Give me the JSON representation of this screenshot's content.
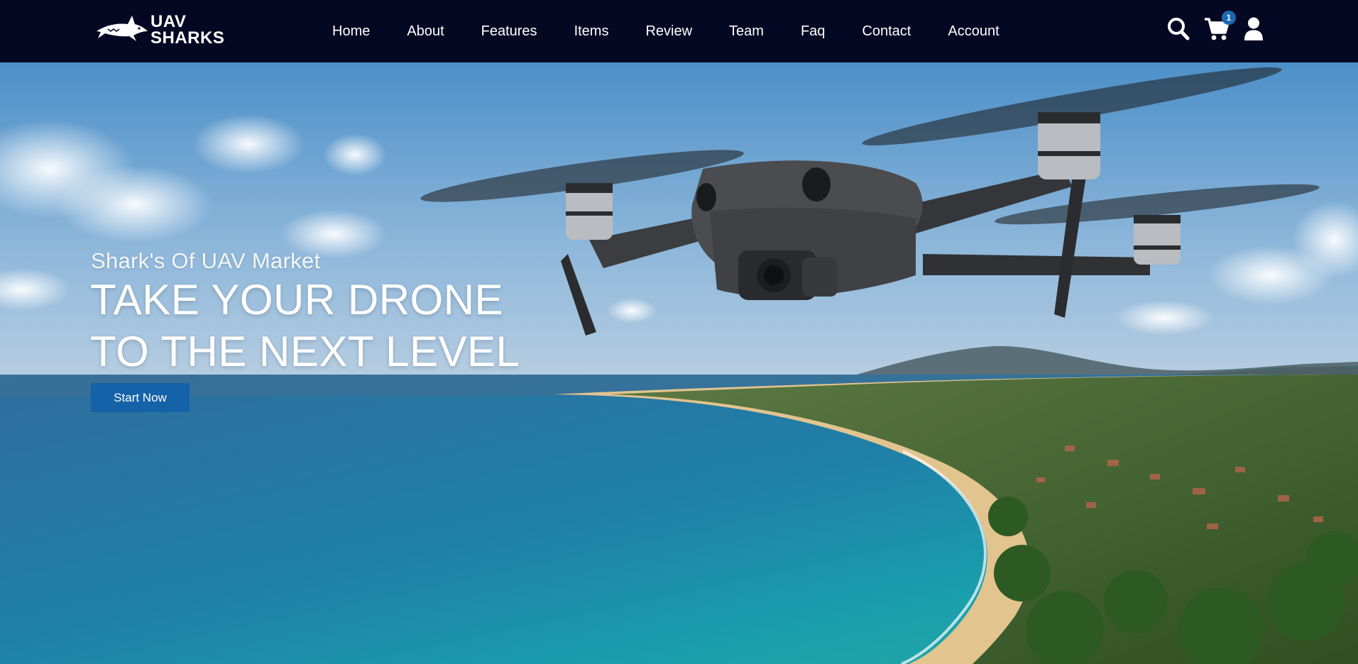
{
  "brand": {
    "line1": "UAV",
    "line2": "SHARKS"
  },
  "nav": {
    "links": [
      "Home",
      "About",
      "Features",
      "Items",
      "Review",
      "Team",
      "Faq",
      "Contact",
      "Account"
    ]
  },
  "icons": {
    "search": "search-icon",
    "cart": "cart-icon",
    "user": "user-icon",
    "cart_count": "1"
  },
  "hero": {
    "subtitle": "Shark's Of UAV Market",
    "title_line1": "TAKE YOUR DRONE",
    "title_line2": "TO THE NEXT LEVEL",
    "cta_label": "Start Now"
  },
  "colors": {
    "navbar_bg": "#050822",
    "accent": "#1462a7",
    "badge": "#1b6ab0"
  }
}
